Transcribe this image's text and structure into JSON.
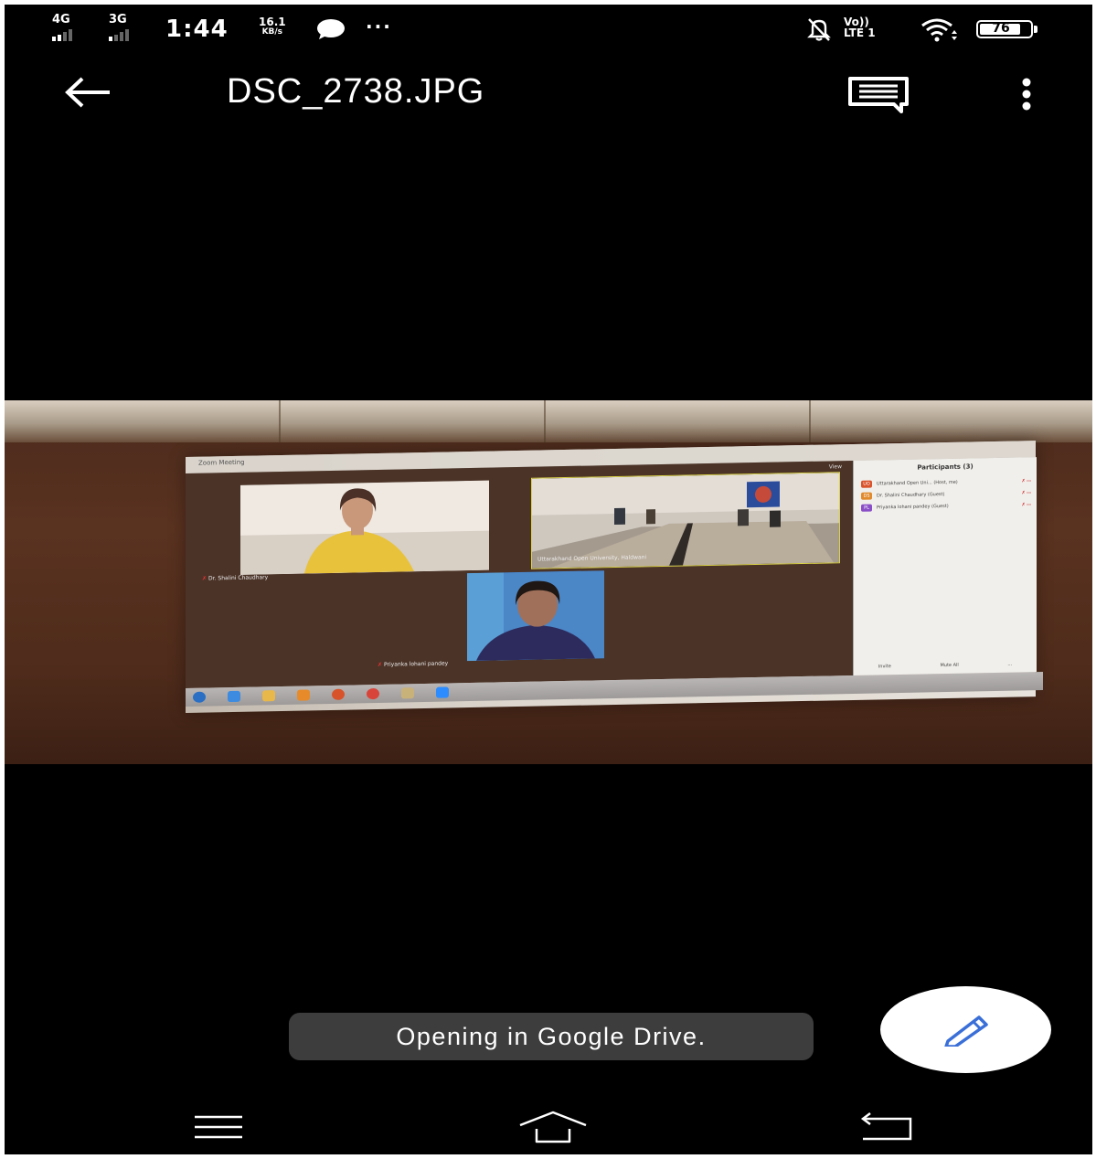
{
  "status_bar": {
    "network_1": "4G",
    "network_2": "3G",
    "time": "1:44",
    "speed_value": "16.1",
    "speed_unit": "KB/s",
    "more_notifications": "···",
    "volte_top": "Vo))",
    "volte_bottom": "LTE 1",
    "battery_level": "76",
    "icons": [
      "chat-bubble-icon",
      "mute-bell-icon",
      "wifi-icon",
      "battery-icon"
    ]
  },
  "app_bar": {
    "title": "DSC_2738.JPG",
    "icons": [
      "back-arrow-icon",
      "comment-icon",
      "more-vert-icon"
    ]
  },
  "photo": {
    "window_title": "Zoom Meeting",
    "view_label": "View",
    "participants_title": "Participants (3)",
    "tiles": [
      {
        "label": "Dr. Shalini Chaudhary"
      },
      {
        "label": "Uttarakhand Open University, Haldwani"
      },
      {
        "label": "Priyanka lohani pandey"
      }
    ],
    "participants": [
      {
        "initials": "UO",
        "name": "Uttarakhand Open Uni... (Host, me)",
        "color": "#d9532b"
      },
      {
        "initials": "DS",
        "name": "Dr. Shalini Chaudhary (Guest)",
        "color": "#e08a2c"
      },
      {
        "initials": "PL",
        "name": "Priyanka lohani pandey (Guest)",
        "color": "#8a4fc7"
      }
    ],
    "footer": [
      "Invite",
      "Mute All",
      "..."
    ]
  },
  "toast": {
    "text": "Opening in Google Drive."
  },
  "fab": {
    "icon": "pencil-edit-icon",
    "accent": "#3a6fd8"
  },
  "nav_bar": {
    "icons": [
      "nav-menu-icon",
      "nav-home-icon",
      "nav-back-icon"
    ]
  }
}
